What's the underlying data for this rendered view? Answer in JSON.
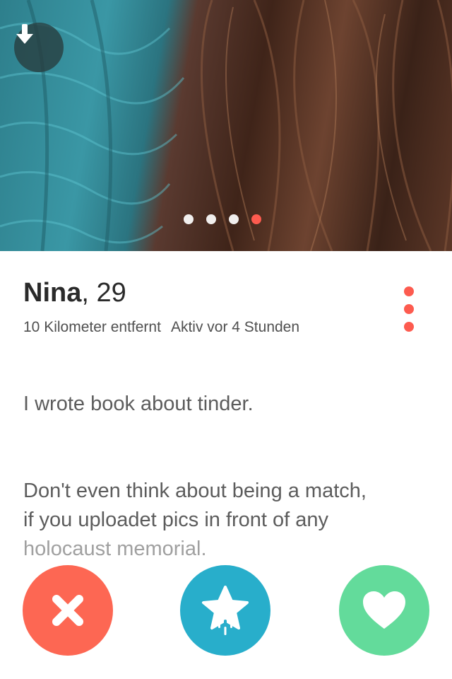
{
  "profile": {
    "name": "Nina",
    "age": ", 29",
    "distance": "10 Kilometer entfernt",
    "active": "Aktiv vor 4 Stunden",
    "bio_line1": "I wrote book about tinder.",
    "bio_line2": "Don't even think about being a match,\nif you uploadet pics in front of any",
    "bio_line3": "holocaust memorial."
  },
  "photo": {
    "count": 4,
    "active_index": 4
  },
  "icons": {
    "download": "arrow-down-icon",
    "more": "more-vertical-icon",
    "nope": "x-icon",
    "superlike": "star-icon",
    "like": "heart-icon"
  },
  "colors": {
    "accent": "#fd5b4f",
    "nope": "#fd6753",
    "superlike": "#28aecb",
    "like": "#63db9b"
  }
}
